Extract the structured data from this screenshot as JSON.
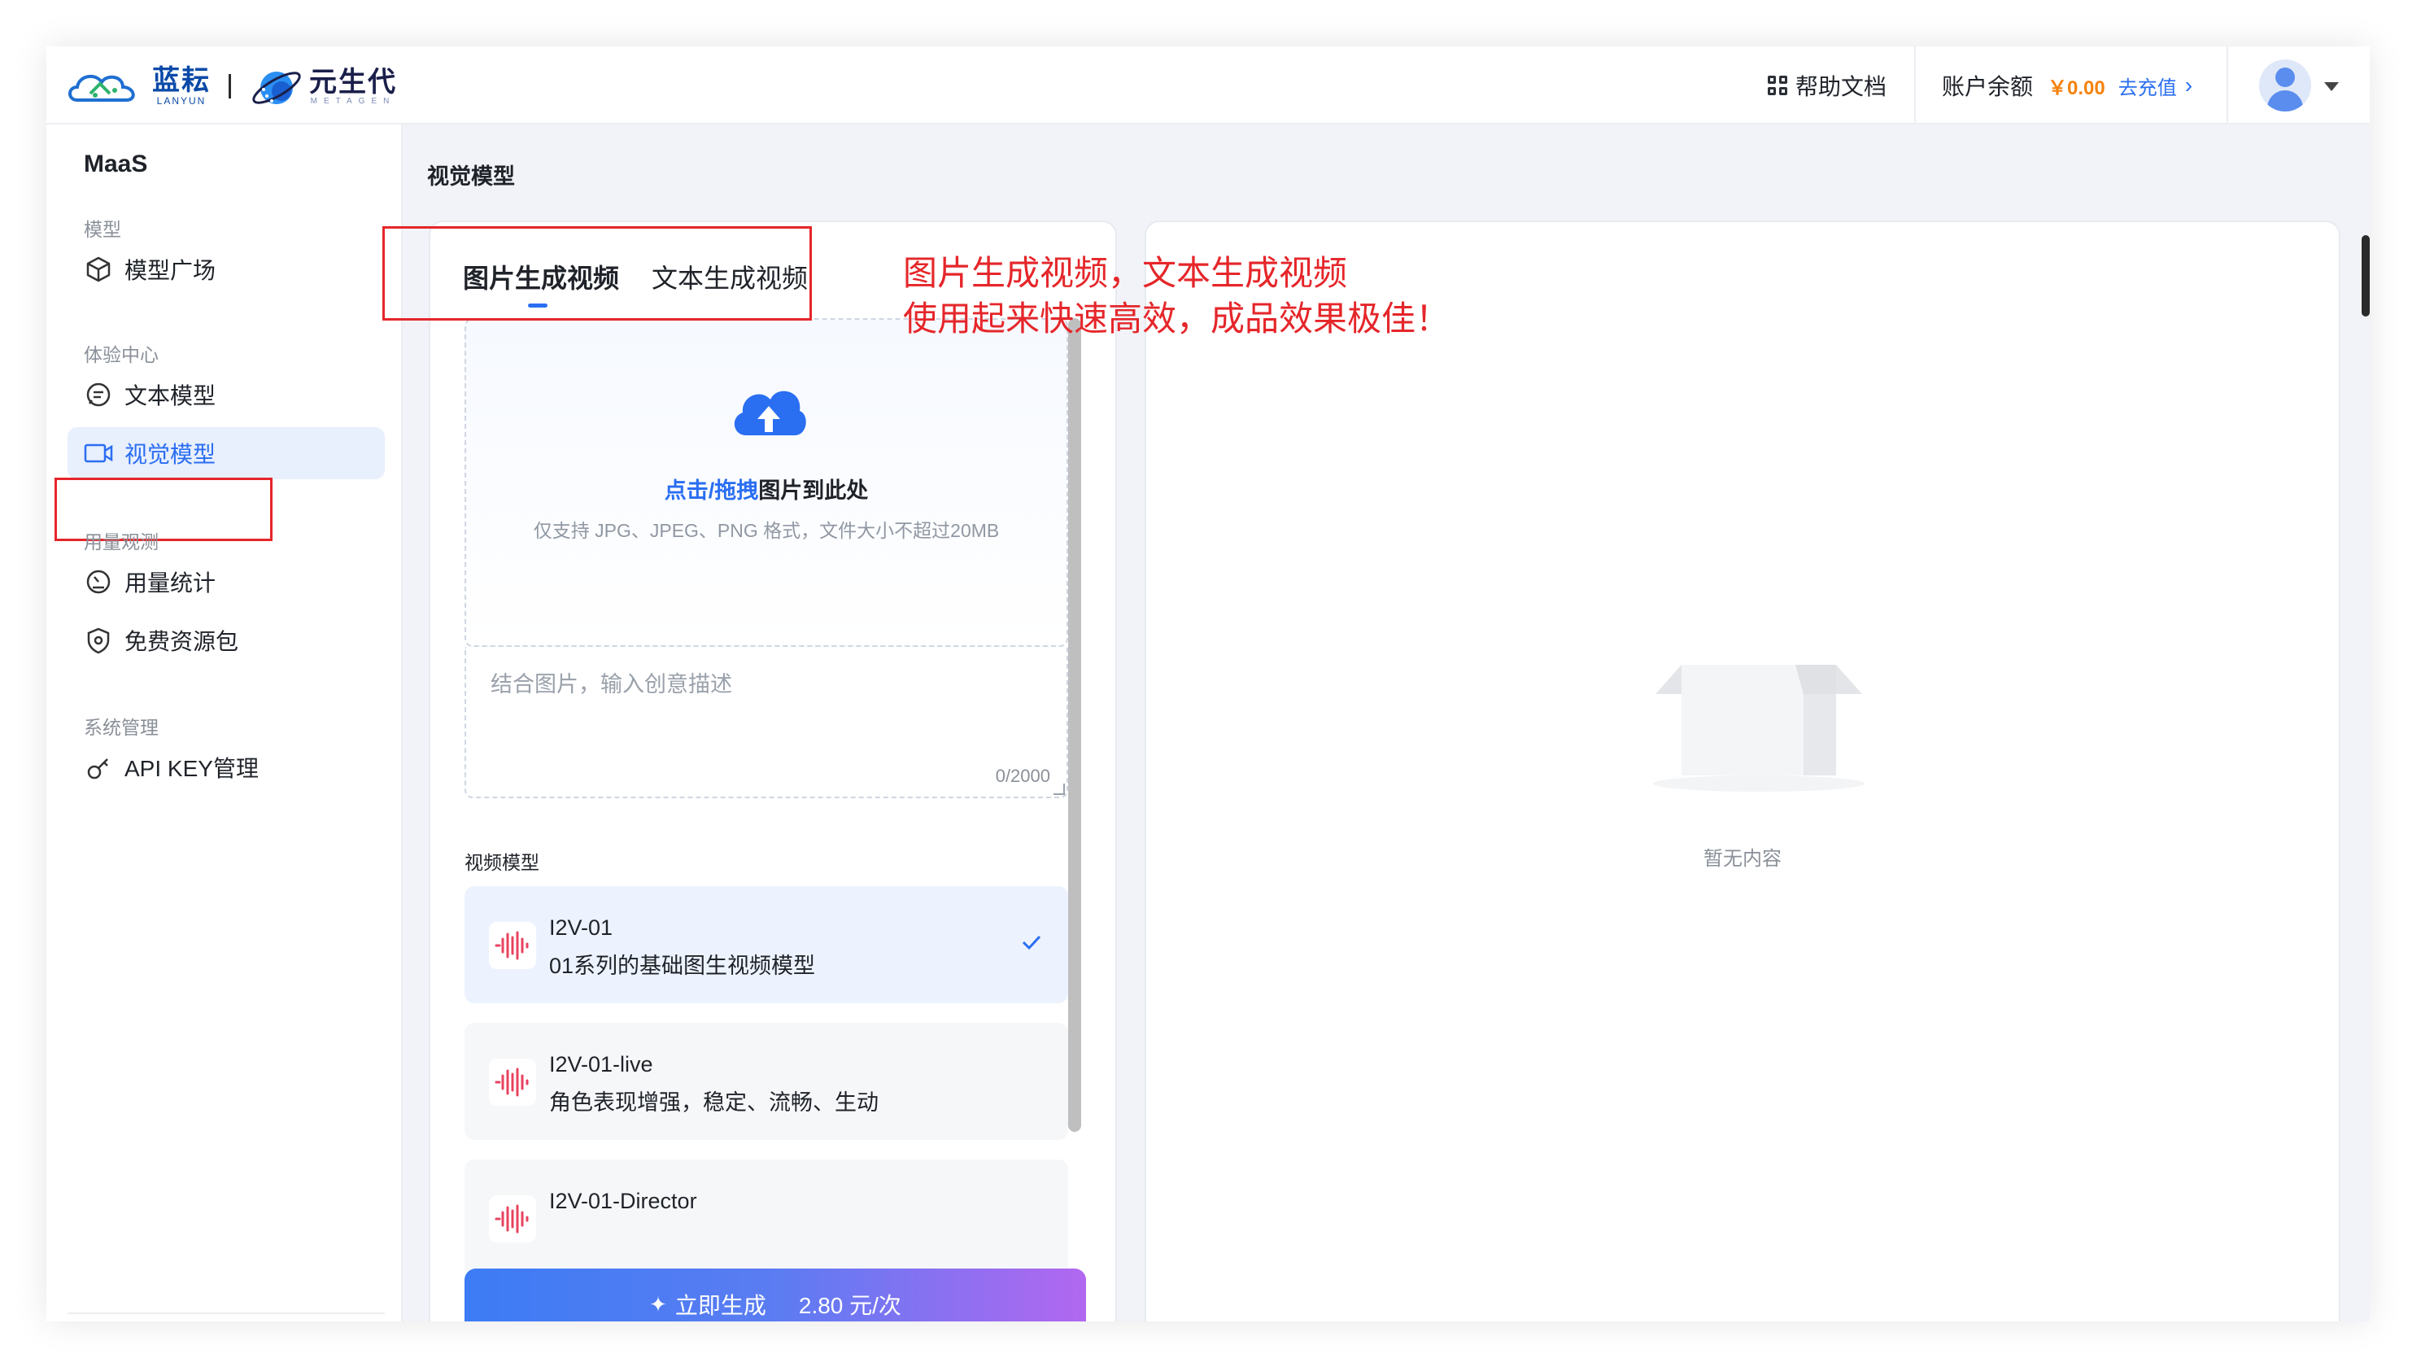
{
  "header": {
    "logo_primary_cn": "蓝耘",
    "logo_primary_en": "LANYUN",
    "logo_secondary_cn": "元生代",
    "logo_secondary_en": "METAGEN",
    "help_label": "帮助文档",
    "balance_label": "账户余额",
    "balance_amount": "￥0.00",
    "recharge_label": "去充值"
  },
  "sidebar": {
    "title": "MaaS",
    "groups": [
      {
        "label": "模型",
        "items": [
          {
            "label": "模型广场",
            "icon": "cube-icon"
          }
        ]
      },
      {
        "label": "体验中心",
        "items": [
          {
            "label": "文本模型",
            "icon": "chat-icon"
          },
          {
            "label": "视觉模型",
            "icon": "video-icon",
            "active": true
          }
        ]
      },
      {
        "label": "用量观测",
        "items": [
          {
            "label": "用量统计",
            "icon": "gauge-icon"
          },
          {
            "label": "免费资源包",
            "icon": "shield-icon"
          }
        ]
      },
      {
        "label": "系统管理",
        "items": [
          {
            "label": "API KEY管理",
            "icon": "key-icon"
          }
        ]
      }
    ]
  },
  "main": {
    "page_title": "视觉模型",
    "tabs": [
      {
        "label": "图片生成视频",
        "active": true
      },
      {
        "label": "文本生成视频"
      }
    ],
    "upload": {
      "cta_blue": "点击/拖拽",
      "cta_rest": "图片到此处",
      "hint": "仅支持 JPG、JPEG、PNG 格式，文件大小不超过20MB"
    },
    "prompt": {
      "placeholder": "结合图片，输入创意描述",
      "count": "0/2000"
    },
    "models_label": "视频模型",
    "models": [
      {
        "name": "I2V-01",
        "desc": "01系列的基础图生视频模型",
        "selected": true
      },
      {
        "name": "I2V-01-live",
        "desc": "角色表现增强，稳定、流畅、生动"
      },
      {
        "name": "I2V-01-Director",
        "desc": ""
      }
    ],
    "generate": {
      "label": "立即生成",
      "price": "2.80 元/次"
    },
    "empty_text": "暂无内容"
  },
  "annotation": {
    "line1": "图片生成视频，文本生成视频",
    "line2": "使用起来快速高效，成品效果极佳！"
  },
  "colors": {
    "accent": "#2a6ef2",
    "annotation": "#e5262a",
    "balance": "#f5820d"
  }
}
